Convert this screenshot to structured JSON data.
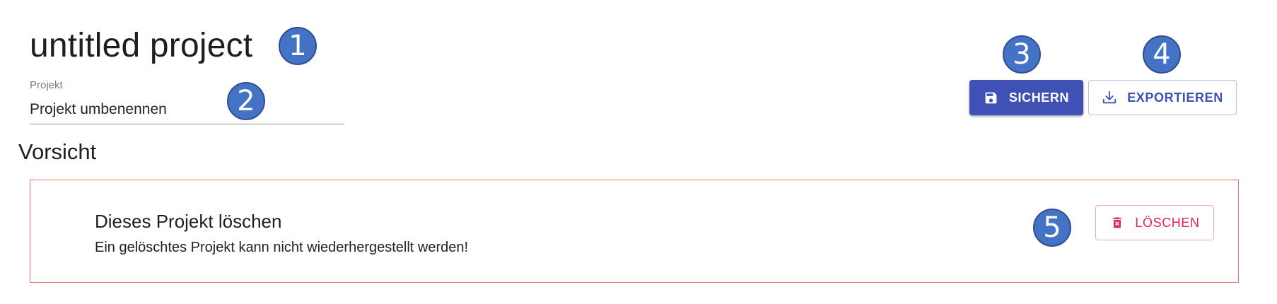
{
  "project": {
    "title": "untitled project"
  },
  "rename_field": {
    "label": "Projekt",
    "placeholder": "Projekt umbenennen"
  },
  "toolbar": {
    "save_label": "SICHERN",
    "export_label": "EXPORTIEREN"
  },
  "danger_zone": {
    "heading": "Vorsicht",
    "title": "Dieses Projekt löschen",
    "description": "Ein gelöschtes Projekt kann nicht wiederhergestellt werden!",
    "delete_label": "LÖSCHEN"
  },
  "callouts": [
    "1",
    "2",
    "3",
    "4",
    "5"
  ],
  "colors": {
    "primary": "#3f51b5",
    "danger": "#e91e63",
    "danger_border": "#f07070",
    "callout": "#4472c4"
  },
  "icons": {
    "save": "floppy-disk-icon",
    "export": "download-tray-icon",
    "delete": "trash-can-icon"
  }
}
